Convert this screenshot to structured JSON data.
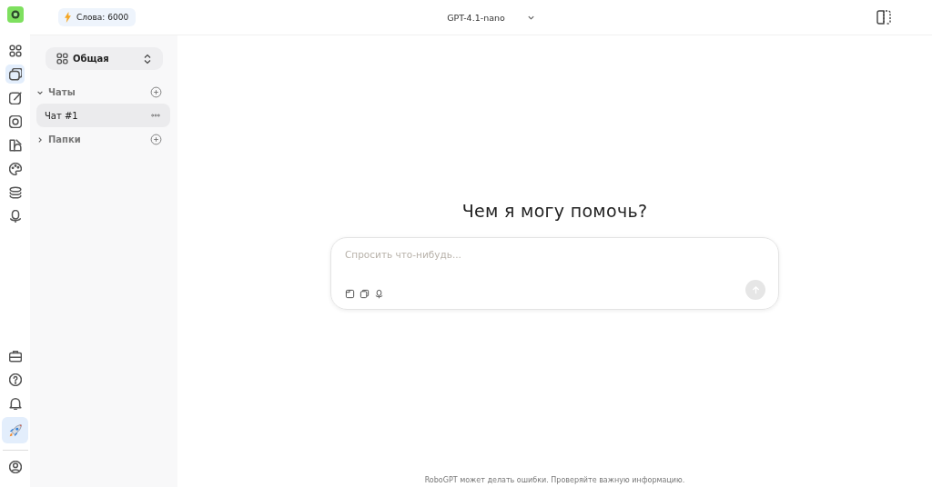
{
  "header": {
    "words_badge": "Слова: 6000",
    "model": "GPT-4.1-nano"
  },
  "rail": {
    "top": [
      {
        "kind": "grid",
        "selected": false
      },
      {
        "kind": "chats",
        "selected": true
      },
      {
        "kind": "edit",
        "selected": false
      },
      {
        "kind": "image",
        "selected": false
      },
      {
        "kind": "book",
        "selected": false
      },
      {
        "kind": "palette",
        "selected": false
      },
      {
        "kind": "layers",
        "selected": false
      },
      {
        "kind": "mic",
        "selected": false
      }
    ],
    "bottom": [
      {
        "kind": "briefcase",
        "selected": false
      },
      {
        "kind": "help",
        "selected": false
      },
      {
        "kind": "bell",
        "selected": false
      },
      {
        "kind": "rocket",
        "selected": true
      },
      {
        "kind": "profile",
        "selected": false
      }
    ]
  },
  "sidebar": {
    "workspace": "Общая",
    "sections": [
      {
        "label": "Чаты",
        "expanded": true,
        "items": [
          {
            "label": "Чат #1",
            "selected": true
          }
        ]
      },
      {
        "label": "Папки",
        "expanded": false
      }
    ]
  },
  "main": {
    "heading": "Чем я могу помочь?",
    "prompt": {
      "placeholder": "Спросить что-нибудь..."
    },
    "footer": "RoboGPT может делать ошибки. Проверяйте важную информацию."
  }
}
